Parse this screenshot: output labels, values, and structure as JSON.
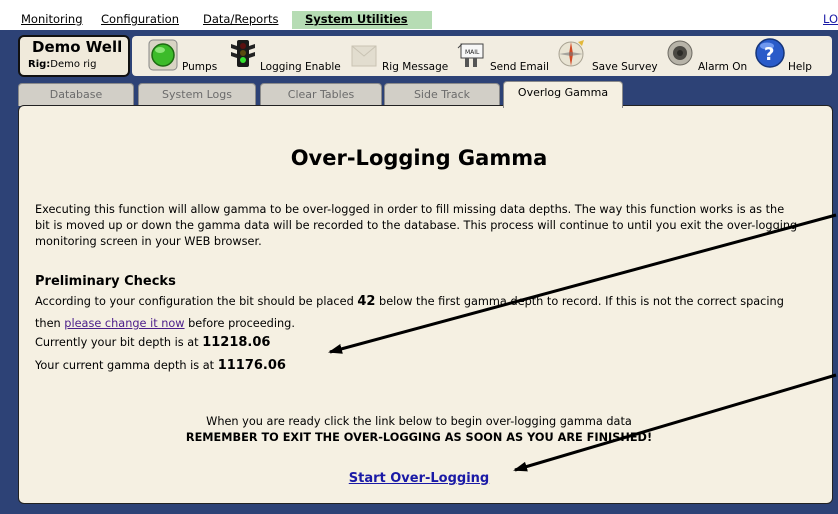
{
  "menu": {
    "monitoring": "Monitoring",
    "configuration": "Configuration",
    "data_reports": "Data/Reports",
    "system_utilities": "System Utilities",
    "logout_partial": "LO"
  },
  "well": {
    "name": "Demo Well",
    "rig_label": "Rig:",
    "rig_value": "Demo rig"
  },
  "toolbar": {
    "pumps": "Pumps",
    "logging_enable": "Logging Enable",
    "rig_message": "Rig Message",
    "send_email": "Send Email",
    "save_survey": "Save Survey",
    "alarm_on": "Alarm On",
    "help": "Help"
  },
  "tabs": [
    {
      "label": "Database"
    },
    {
      "label": "System Logs"
    },
    {
      "label": "Clear Tables"
    },
    {
      "label": "Side Track"
    },
    {
      "label": "Overlog Gamma"
    }
  ],
  "content": {
    "title": "Over-Logging Gamma",
    "intro_line1": "Executing this function will allow gamma to be over-logged in order to fill missing data depths. The way this function works is as the",
    "intro_line2": "bit is moved up or down the gamma data will be recorded to the database. This process will continue to until you exit the over-logging",
    "intro_line3": "monitoring screen in your WEB browser.",
    "prelim_heading": "Preliminary Checks",
    "config_pre": "According to your configuration the bit should be placed",
    "config_value": "42",
    "config_post": "below the first gamma depth to record. If this is not the correct spacing",
    "then_text": "then",
    "change_link": "please change it now",
    "before_text": "before proceeding.",
    "bit_depth_label": "Currently your bit depth is at",
    "bit_depth_value": "11218.06",
    "gamma_depth_label": "Your current gamma depth is at",
    "gamma_depth_value": "11176.06",
    "ready_text": "When you are ready click the link below to begin over-logging gamma data",
    "remember_text": "REMEMBER TO EXIT THE OVER-LOGGING AS SOON AS YOU ARE FINISHED!",
    "start_link": "Start Over-Logging"
  },
  "colors": {
    "band": "#2d4276",
    "panel": "#f5f0e2",
    "system_utilities_highlight": "#b6dcb4",
    "link": "#1a1aa6"
  },
  "icons": [
    "green-circle-icon",
    "traffic-light-icon",
    "rig-message-icon",
    "send-email-icon",
    "save-survey-icon",
    "alarm-icon",
    "help-icon",
    "arrow-icon"
  ]
}
